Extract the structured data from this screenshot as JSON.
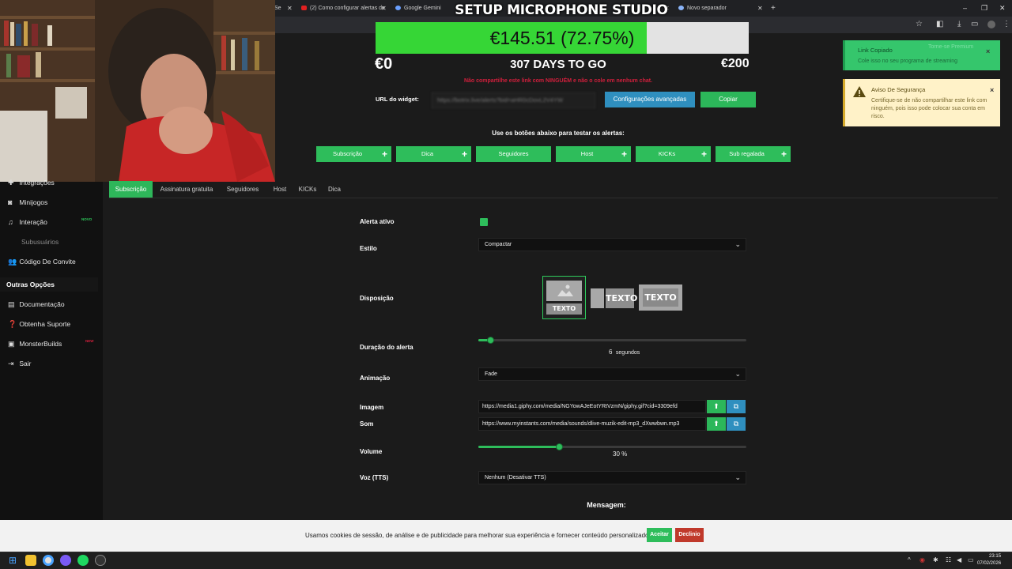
{
  "browser": {
    "tabs": [
      {
        "title": "Se"
      },
      {
        "title": "(2) Como configurar alertas de"
      },
      {
        "title": "Google Gemini"
      },
      {
        "title": "Novo separador"
      }
    ],
    "new_tab": "+",
    "controls": {
      "minimize": "–",
      "maximize": "❐",
      "close": "✕"
    }
  },
  "goal": {
    "title": "SETUP MICROPHONE STUDIO",
    "amount_text": "€145.51 (72.75%)",
    "progress_fraction": 0.7275,
    "min_label": "€0",
    "max_label": "€200",
    "days_left": "307 DAYS TO GO"
  },
  "sidebar": {
    "items": [
      {
        "label": "Integrações",
        "icon": "puzzle-icon"
      },
      {
        "label": "Minijogos",
        "icon": "gamepad-icon"
      },
      {
        "label": "Interação",
        "icon": "music-icon",
        "badge": "NOVO"
      },
      {
        "label": "Subusuários",
        "icon": "",
        "dim": true
      },
      {
        "label": "Código De Convite",
        "icon": "users-icon"
      }
    ],
    "section_title": "Outras Opções",
    "other_items": [
      {
        "label": "Documentação",
        "icon": "book-icon"
      },
      {
        "label": "Obtenha Suporte",
        "icon": "help-icon"
      },
      {
        "label": "MonsterBuilds",
        "icon": "monitor-icon",
        "badge": "NEW"
      },
      {
        "label": "Sair",
        "icon": "logout-icon"
      }
    ]
  },
  "widget": {
    "warning": "Não compartilhe este link com NINGUÉM e não o cole em nenhum chat.",
    "url_label": "URL do widget:",
    "url_value": "https://botrix.live/alerts?bid=aHR0cDovL2V4YW",
    "advanced_button": "Configurações avançadas",
    "copy_button": "Copiar",
    "test_hint": "Use os botões abaixo para testar os alertas:",
    "test_buttons": [
      {
        "label": "Subscrição",
        "has_plus": true
      },
      {
        "label": "Dica",
        "has_plus": true
      },
      {
        "label": "Seguidores",
        "has_plus": false
      },
      {
        "label": "Host",
        "has_plus": true
      },
      {
        "label": "KICKs",
        "has_plus": true
      },
      {
        "label": "Sub regalada",
        "has_plus": true
      }
    ]
  },
  "toasts": {
    "success": {
      "title": "Link Copiado",
      "body": "Cole isso no seu programa de streaming",
      "extra": "Torne-se Premium"
    },
    "warning": {
      "title": "Aviso De Segurança",
      "body": "Certifique-se de não compartilhar este link com ninguém, pois isso pode colocar sua conta em risco."
    }
  },
  "settings": {
    "tabs": [
      "Subscrição",
      "Assinatura gratuita",
      "Seguidores",
      "Host",
      "KICKs",
      "Dica"
    ],
    "active_tab": "Subscrição",
    "alert_active_label": "Alerta ativo",
    "alert_active": true,
    "style_label": "Estilo",
    "style_value": "Compactar",
    "layout_label": "Disposição",
    "layout_text": "TEXTO",
    "duration_label": "Duração do alerta",
    "duration_value": "6",
    "duration_unit": "segundos",
    "duration_fraction": 0.045,
    "animation_label": "Animação",
    "animation_value": "Fade",
    "image_label": "Imagem",
    "image_url": "https://media1.giphy.com/media/NGYowAJeEotYRtVzmN/giphy.gif?cid=3309efd",
    "sound_label": "Som",
    "sound_url": "https://www.myinstants.com/media/sounds/dlive-muzik-edit-mp3_dXwwbwn.mp3",
    "volume_label": "Volume",
    "volume_value": "30",
    "volume_unit": "%",
    "volume_fraction": 0.3,
    "tts_label": "Voz (TTS)",
    "tts_value": "Nenhum (Desativar TTS)",
    "message_title": "Mensagem:"
  },
  "cookie": {
    "text": "Usamos cookies de sessão, de análise e de publicidade para melhorar sua experiência e fornecer conteúdo personalizado.",
    "accept": "Aceitar",
    "decline": "Declinio"
  },
  "taskbar": {
    "time": "23:15",
    "date": "07/02/2026"
  },
  "colors": {
    "accent_green": "#2ebd5b",
    "info_blue": "#2f8fbf",
    "danger_red": "#d21f3c",
    "decline_red": "#c0392b"
  }
}
